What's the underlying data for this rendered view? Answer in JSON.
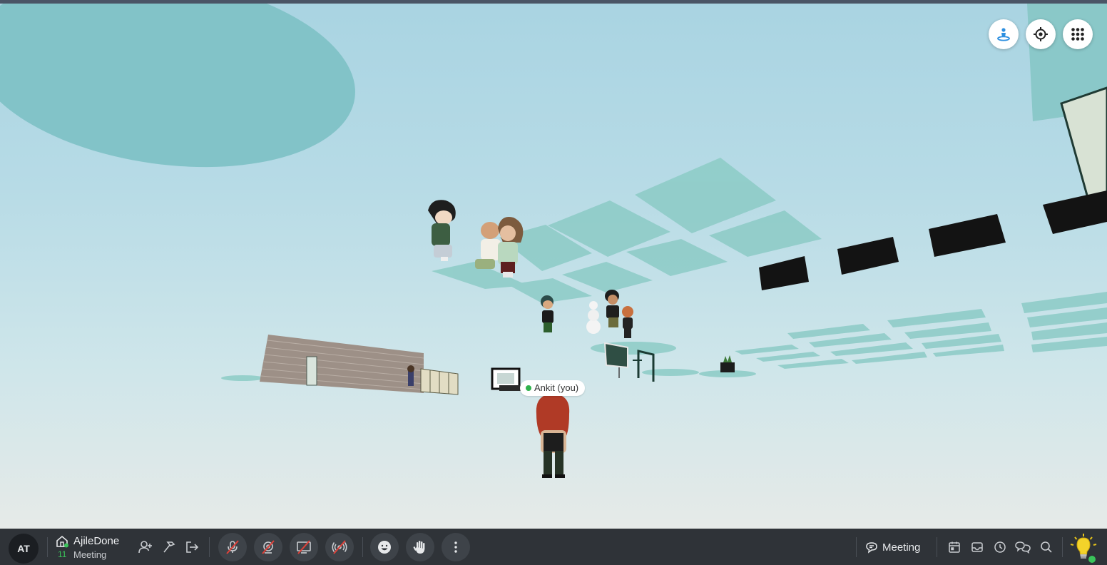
{
  "viewport": {
    "self_nametag": "Ankit (you)"
  },
  "top_controls": {
    "icons": [
      "avatar-view-icon",
      "locate-icon",
      "apps-grid-icon"
    ]
  },
  "bottom_bar": {
    "user_initials": "AT",
    "space_name": "AjileDone",
    "space_subtitle": "Meeting",
    "online_count": "11",
    "meeting_label": "Meeting",
    "colors": {
      "bar_bg": "#2f3338",
      "online_green": "#3ac45a",
      "muted_red": "#e0423a"
    }
  }
}
